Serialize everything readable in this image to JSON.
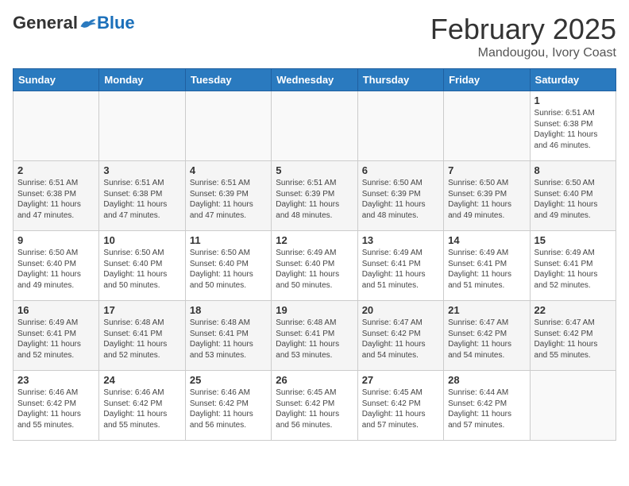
{
  "header": {
    "logo_general": "General",
    "logo_blue": "Blue",
    "month": "February 2025",
    "location": "Mandougou, Ivory Coast"
  },
  "weekdays": [
    "Sunday",
    "Monday",
    "Tuesday",
    "Wednesday",
    "Thursday",
    "Friday",
    "Saturday"
  ],
  "weeks": [
    [
      {
        "day": "",
        "info": ""
      },
      {
        "day": "",
        "info": ""
      },
      {
        "day": "",
        "info": ""
      },
      {
        "day": "",
        "info": ""
      },
      {
        "day": "",
        "info": ""
      },
      {
        "day": "",
        "info": ""
      },
      {
        "day": "1",
        "info": "Sunrise: 6:51 AM\nSunset: 6:38 PM\nDaylight: 11 hours and 46 minutes."
      }
    ],
    [
      {
        "day": "2",
        "info": "Sunrise: 6:51 AM\nSunset: 6:38 PM\nDaylight: 11 hours and 47 minutes."
      },
      {
        "day": "3",
        "info": "Sunrise: 6:51 AM\nSunset: 6:38 PM\nDaylight: 11 hours and 47 minutes."
      },
      {
        "day": "4",
        "info": "Sunrise: 6:51 AM\nSunset: 6:39 PM\nDaylight: 11 hours and 47 minutes."
      },
      {
        "day": "5",
        "info": "Sunrise: 6:51 AM\nSunset: 6:39 PM\nDaylight: 11 hours and 48 minutes."
      },
      {
        "day": "6",
        "info": "Sunrise: 6:50 AM\nSunset: 6:39 PM\nDaylight: 11 hours and 48 minutes."
      },
      {
        "day": "7",
        "info": "Sunrise: 6:50 AM\nSunset: 6:39 PM\nDaylight: 11 hours and 49 minutes."
      },
      {
        "day": "8",
        "info": "Sunrise: 6:50 AM\nSunset: 6:40 PM\nDaylight: 11 hours and 49 minutes."
      }
    ],
    [
      {
        "day": "9",
        "info": "Sunrise: 6:50 AM\nSunset: 6:40 PM\nDaylight: 11 hours and 49 minutes."
      },
      {
        "day": "10",
        "info": "Sunrise: 6:50 AM\nSunset: 6:40 PM\nDaylight: 11 hours and 50 minutes."
      },
      {
        "day": "11",
        "info": "Sunrise: 6:50 AM\nSunset: 6:40 PM\nDaylight: 11 hours and 50 minutes."
      },
      {
        "day": "12",
        "info": "Sunrise: 6:49 AM\nSunset: 6:40 PM\nDaylight: 11 hours and 50 minutes."
      },
      {
        "day": "13",
        "info": "Sunrise: 6:49 AM\nSunset: 6:41 PM\nDaylight: 11 hours and 51 minutes."
      },
      {
        "day": "14",
        "info": "Sunrise: 6:49 AM\nSunset: 6:41 PM\nDaylight: 11 hours and 51 minutes."
      },
      {
        "day": "15",
        "info": "Sunrise: 6:49 AM\nSunset: 6:41 PM\nDaylight: 11 hours and 52 minutes."
      }
    ],
    [
      {
        "day": "16",
        "info": "Sunrise: 6:49 AM\nSunset: 6:41 PM\nDaylight: 11 hours and 52 minutes."
      },
      {
        "day": "17",
        "info": "Sunrise: 6:48 AM\nSunset: 6:41 PM\nDaylight: 11 hours and 52 minutes."
      },
      {
        "day": "18",
        "info": "Sunrise: 6:48 AM\nSunset: 6:41 PM\nDaylight: 11 hours and 53 minutes."
      },
      {
        "day": "19",
        "info": "Sunrise: 6:48 AM\nSunset: 6:41 PM\nDaylight: 11 hours and 53 minutes."
      },
      {
        "day": "20",
        "info": "Sunrise: 6:47 AM\nSunset: 6:42 PM\nDaylight: 11 hours and 54 minutes."
      },
      {
        "day": "21",
        "info": "Sunrise: 6:47 AM\nSunset: 6:42 PM\nDaylight: 11 hours and 54 minutes."
      },
      {
        "day": "22",
        "info": "Sunrise: 6:47 AM\nSunset: 6:42 PM\nDaylight: 11 hours and 55 minutes."
      }
    ],
    [
      {
        "day": "23",
        "info": "Sunrise: 6:46 AM\nSunset: 6:42 PM\nDaylight: 11 hours and 55 minutes."
      },
      {
        "day": "24",
        "info": "Sunrise: 6:46 AM\nSunset: 6:42 PM\nDaylight: 11 hours and 55 minutes."
      },
      {
        "day": "25",
        "info": "Sunrise: 6:46 AM\nSunset: 6:42 PM\nDaylight: 11 hours and 56 minutes."
      },
      {
        "day": "26",
        "info": "Sunrise: 6:45 AM\nSunset: 6:42 PM\nDaylight: 11 hours and 56 minutes."
      },
      {
        "day": "27",
        "info": "Sunrise: 6:45 AM\nSunset: 6:42 PM\nDaylight: 11 hours and 57 minutes."
      },
      {
        "day": "28",
        "info": "Sunrise: 6:44 AM\nSunset: 6:42 PM\nDaylight: 11 hours and 57 minutes."
      },
      {
        "day": "",
        "info": ""
      }
    ]
  ]
}
